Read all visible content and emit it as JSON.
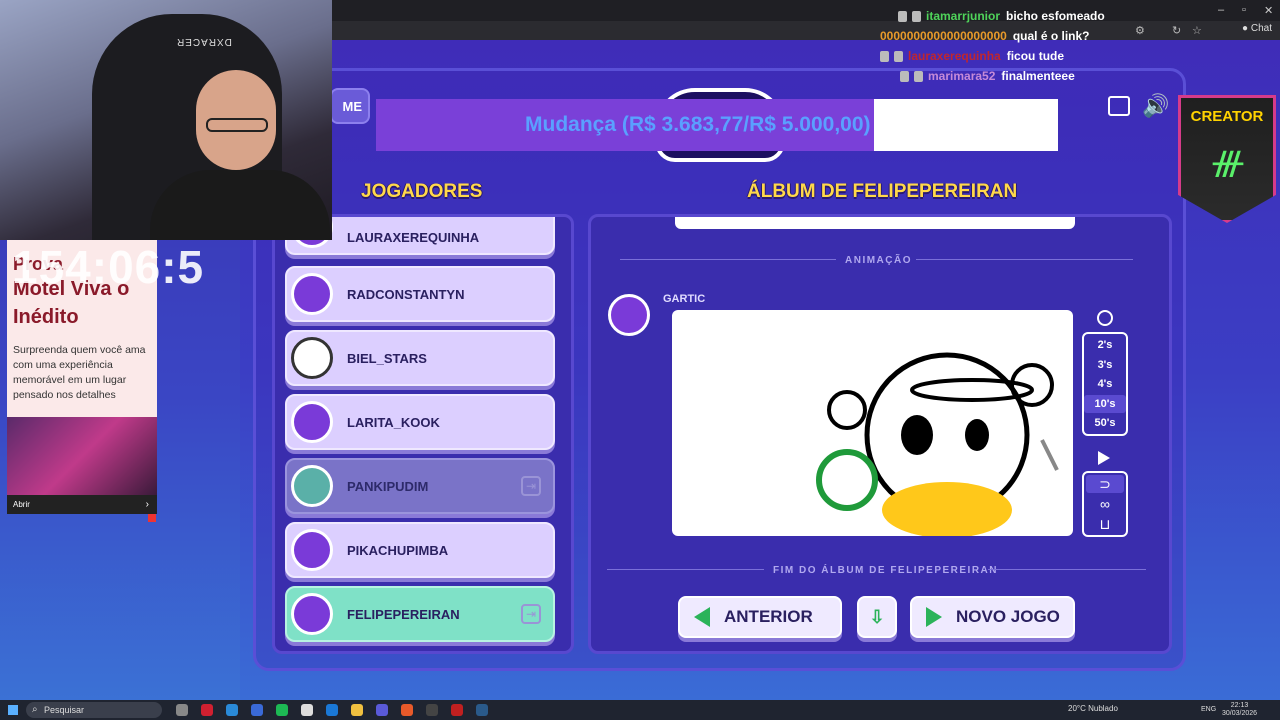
{
  "chat": [
    {
      "user": "itamarrjunior",
      "message": "bicho esfomeado",
      "color": "#4fd35a"
    },
    {
      "user": "0000000000000000000",
      "message": "qual é o link?",
      "color": "#e89a2a"
    },
    {
      "user": "lauraxerequinha",
      "message": "ficou tude",
      "color": "#c0262e"
    },
    {
      "user": "marimara52",
      "message": "finalmenteee",
      "color": "#c58ad8"
    }
  ],
  "browser": {
    "chat_button": "Chat"
  },
  "game": {
    "home_label": "ME",
    "goal_text": "Mudança (R$ 3.683,77/R$ 5.000,00)",
    "goal_progress": 0.73,
    "players_title": "JOGADORES",
    "album_title": "ÁLBUM DE FELIPEPEREIRAN",
    "players": [
      {
        "name": "LAURAXEREQUINHA",
        "state": "normal"
      },
      {
        "name": "RADCONSTANTYN",
        "state": "normal"
      },
      {
        "name": "BIEL_STARS",
        "state": "normal",
        "avatar": "panda"
      },
      {
        "name": "LARITA_KOOK",
        "state": "normal"
      },
      {
        "name": "PANKIPUDIM",
        "state": "inactive",
        "avatar": "robot"
      },
      {
        "name": "PIKACHUPIMBA",
        "state": "normal"
      },
      {
        "name": "FELIPEPEREIRAN",
        "state": "active"
      }
    ],
    "animation_label": "ANIMAÇÃO",
    "drawer_name": "GARTIC",
    "speeds": [
      "2's",
      "3's",
      "4's",
      "10's",
      "50's"
    ],
    "selected_speed": "10's",
    "loop_options": [
      "⊃",
      "∞",
      "⊔"
    ],
    "end_label": "FIM DO ÁLBUM DE FELIPEPEREIRAN",
    "prev_button": "ANTERIOR",
    "new_game_button": "NOVO JOGO"
  },
  "creator_badge": "CREATOR",
  "stream_timer": "154:06:5",
  "ad": {
    "title_partial": "Prova",
    "title": "Motel Viva o Inédito",
    "body": "Surpreenda quem você ama com uma experiência memorável em um lugar pensado nos detalhes",
    "footer": "Abrir"
  },
  "taskbar": {
    "search": "Pesquisar",
    "weather": "20°C  Nublado",
    "lang": "ENG",
    "time": "22:13",
    "date": "30/03/2026"
  }
}
